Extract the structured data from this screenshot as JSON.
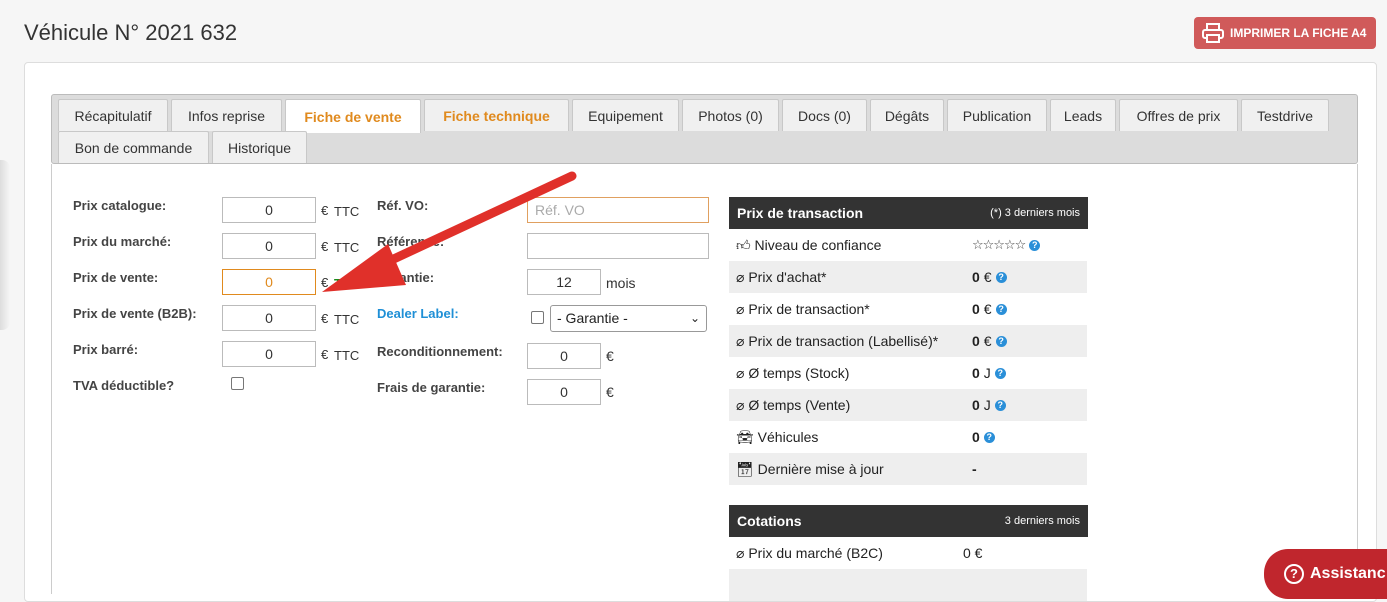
{
  "page": {
    "title": "Véhicule N° 2021 632",
    "print_label": "IMPRIMER LA FICHE A4"
  },
  "tabs": [
    {
      "label": "Récapitulatif"
    },
    {
      "label": "Infos reprise"
    },
    {
      "label": "Fiche de vente"
    },
    {
      "label": "Fiche technique"
    },
    {
      "label": "Equipement"
    },
    {
      "label": "Photos (0)"
    },
    {
      "label": "Docs (0)"
    },
    {
      "label": "Dégâts"
    },
    {
      "label": "Publication"
    },
    {
      "label": "Leads"
    },
    {
      "label": "Offres de prix"
    },
    {
      "label": "Testdrive"
    },
    {
      "label": "Bon de commande"
    },
    {
      "label": "Historique"
    }
  ],
  "prices": {
    "catalogue_label": "Prix catalogue:",
    "catalogue_value": "0",
    "marche_label": "Prix du marché:",
    "marche_value": "0",
    "vente_label": "Prix de vente:",
    "vente_value": "0",
    "vente_b2b_label": "Prix de vente (B2B):",
    "vente_b2b_value": "0",
    "barre_label": "Prix barré:",
    "barre_value": "0",
    "tva_label": "TVA déductible?",
    "unit_eur": "€",
    "unit_ttc": "TTC"
  },
  "middle": {
    "ref_vo_label": "Réf. VO:",
    "ref_vo_placeholder": "Réf. VO",
    "ref_label": "Référence:",
    "garantie_label": "Garantie:",
    "garantie_value": "12",
    "garantie_unit": "mois",
    "dealer_label": "Dealer Label:",
    "dealer_select": "- Garantie -",
    "recond_label": "Reconditionnement:",
    "recond_value": "0",
    "frais_label": "Frais de garantie:",
    "frais_value": "0",
    "unit_eur": "€"
  },
  "transaction": {
    "title": "Prix de transaction",
    "subtitle": "(*) 3 derniers mois",
    "rows": [
      {
        "name": "Niveau de confiance",
        "icon": "thumbs-up-icon",
        "value": "☆☆☆☆☆"
      },
      {
        "name": "Prix d'achat*",
        "icon": "diameter-icon",
        "value": "0",
        "unit": "€"
      },
      {
        "name": "Prix de transaction*",
        "icon": "diameter-icon",
        "value": "0",
        "unit": "€"
      },
      {
        "name": "Prix de transaction (Labellisé)*",
        "icon": "diameter-icon",
        "value": "0",
        "unit": "€"
      },
      {
        "name": "Ø temps (Stock)",
        "icon": "diameter-icon",
        "value": "0",
        "unit": "J"
      },
      {
        "name": "Ø temps (Vente)",
        "icon": "diameter-icon",
        "value": "0",
        "unit": "J"
      },
      {
        "name": "Véhicules",
        "icon": "car-icon",
        "value": "0"
      },
      {
        "name": "Dernière mise à jour",
        "icon": "calendar-check-icon",
        "value": "-"
      }
    ]
  },
  "cotations": {
    "title": "Cotations",
    "subtitle": "3 derniers mois",
    "rows": [
      {
        "name": "Prix du marché (B2C)",
        "value": "0 €"
      }
    ]
  },
  "assistance": {
    "label": "Assistanc"
  },
  "colors": {
    "accent": "#e08a1e",
    "print": "#d05a5a",
    "assist": "#c0262d",
    "arrow": "#e0302a"
  }
}
